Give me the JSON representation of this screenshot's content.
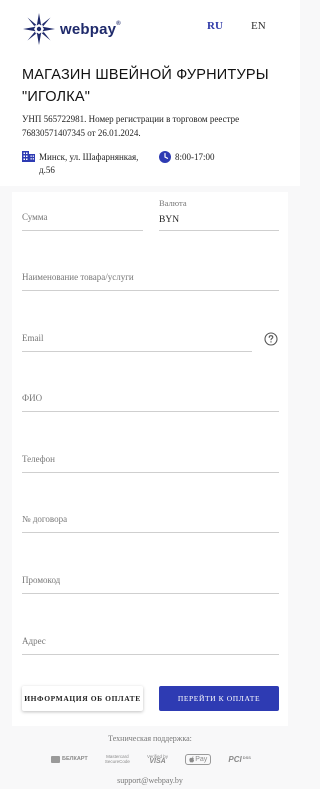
{
  "header": {
    "logo_text": "webpay",
    "logo_reg": "®",
    "lang_ru": "RU",
    "lang_en": "EN"
  },
  "merchant": {
    "title": "МАГАЗИН ШВЕЙНОЙ ФУРНИТУРЫ \"ИГОЛКА\"",
    "registration": "УНП 565722981. Номер регистрации в торговом реестре 76830571407345 от 26.01.2024.",
    "address": "Минск, ул. Шафарнянкая, д.56",
    "hours": "8:00-17:00"
  },
  "form": {
    "amount_placeholder": "Сумма",
    "currency_label": "Валюта",
    "currency_value": "BYN",
    "product_placeholder": "Наименование товара/услуги",
    "email_placeholder": "Email",
    "fio_placeholder": "ФИО",
    "phone_placeholder": "Телефон",
    "contract_placeholder": "№ договора",
    "promo_placeholder": "Промокод",
    "address_placeholder": "Адрес",
    "info_button": "ИНФОРМАЦИЯ ОБ ОПЛАТЕ",
    "pay_button": "ПЕРЕЙТИ К ОПЛАТЕ"
  },
  "footer": {
    "support_label": "Техническая поддержка:",
    "support_email": "support@webpay.by",
    "badges": {
      "belkart": "БЕЛКАРТ",
      "mastercard_line1": "Mastercard",
      "mastercard_line2": "SecureCode",
      "visa_line1": "Verified by",
      "visa_line2": "VISA",
      "applepay": "Pay",
      "pci": "PCI",
      "pci_dss": "DSS"
    }
  },
  "colors": {
    "accent": "#2e3bb3",
    "logo": "#1f2a6b",
    "lang_active": "#2f3aa8"
  },
  "icons": [
    "webpay-star-logo",
    "building-icon",
    "clock-icon",
    "help-circle-icon",
    "apple-icon"
  ]
}
